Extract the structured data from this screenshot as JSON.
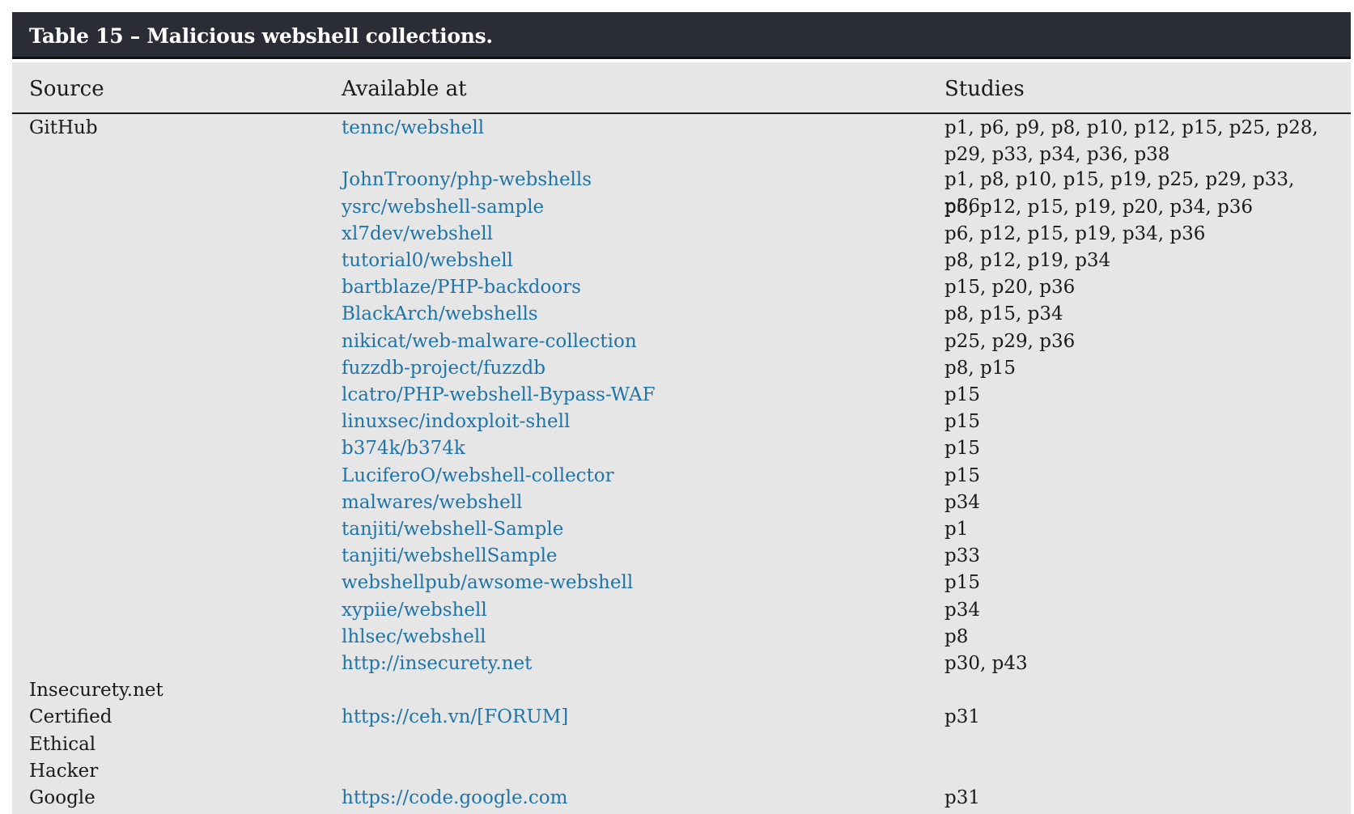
{
  "caption": "Table 15 – Malicious webshell collections.",
  "headers": {
    "source": "Source",
    "available": "Available at",
    "studies": "Studies"
  },
  "rows": [
    {
      "source": "GitHub",
      "available": "tennc/webshell",
      "studies": "p1, p6, p9, p8, p10, p12, p15, p25, p28, p29, p33, p34, p36, p38"
    },
    {
      "source": "",
      "available": "JohnTroony/php-webshells",
      "studies": "p1, p8, p10, p15, p19, p25, p29, p33, p36"
    },
    {
      "source": "",
      "available": "ysrc/webshell-sample",
      "studies": "p6, p12, p15, p19, p20, p34, p36"
    },
    {
      "source": "",
      "available": "xl7dev/webshell",
      "studies": "p6, p12, p15, p19, p34, p36"
    },
    {
      "source": "",
      "available": "tutorial0/webshell",
      "studies": "p8, p12, p19, p34"
    },
    {
      "source": "",
      "available": "bartblaze/PHP-backdoors",
      "studies": "p15, p20, p36"
    },
    {
      "source": "",
      "available": "BlackArch/webshells",
      "studies": "p8, p15, p34"
    },
    {
      "source": "",
      "available": "nikicat/web-malware-collection",
      "studies": "p25, p29, p36"
    },
    {
      "source": "",
      "available": "fuzzdb-project/fuzzdb",
      "studies": "p8, p15"
    },
    {
      "source": "",
      "available": "lcatro/PHP-webshell-Bypass-WAF",
      "studies": "p15"
    },
    {
      "source": "",
      "available": "linuxsec/indoxploit-shell",
      "studies": "p15"
    },
    {
      "source": "",
      "available": "b374k/b374k",
      "studies": "p15"
    },
    {
      "source": "",
      "available": "LuciferoO/webshell-collector",
      "studies": "p15"
    },
    {
      "source": "",
      "available": "malwares/webshell",
      "studies": "p34"
    },
    {
      "source": "",
      "available": "tanjiti/webshell-Sample",
      "studies": "p1"
    },
    {
      "source": "",
      "available": "tanjiti/webshellSample",
      "studies": "p33"
    },
    {
      "source": "",
      "available": "webshellpub/awsome-webshell",
      "studies": "p15"
    },
    {
      "source": "",
      "available": "xypiie/webshell",
      "studies": "p34"
    },
    {
      "source": "",
      "available": "lhlsec/webshell",
      "studies": "p8"
    },
    {
      "source": "",
      "available": "http://insecurety.net",
      "studies": "p30, p43"
    },
    {
      "source": "Insecurety.net",
      "available": "",
      "studies": ""
    },
    {
      "source": "Certified",
      "available": "https://ceh.vn/[FORUM]",
      "studies": "p31"
    },
    {
      "source": "Ethical",
      "available": "",
      "studies": ""
    },
    {
      "source": "Hacker",
      "available": "",
      "studies": ""
    },
    {
      "source": "Google",
      "available": "https://code.google.com",
      "studies": "p31"
    }
  ]
}
